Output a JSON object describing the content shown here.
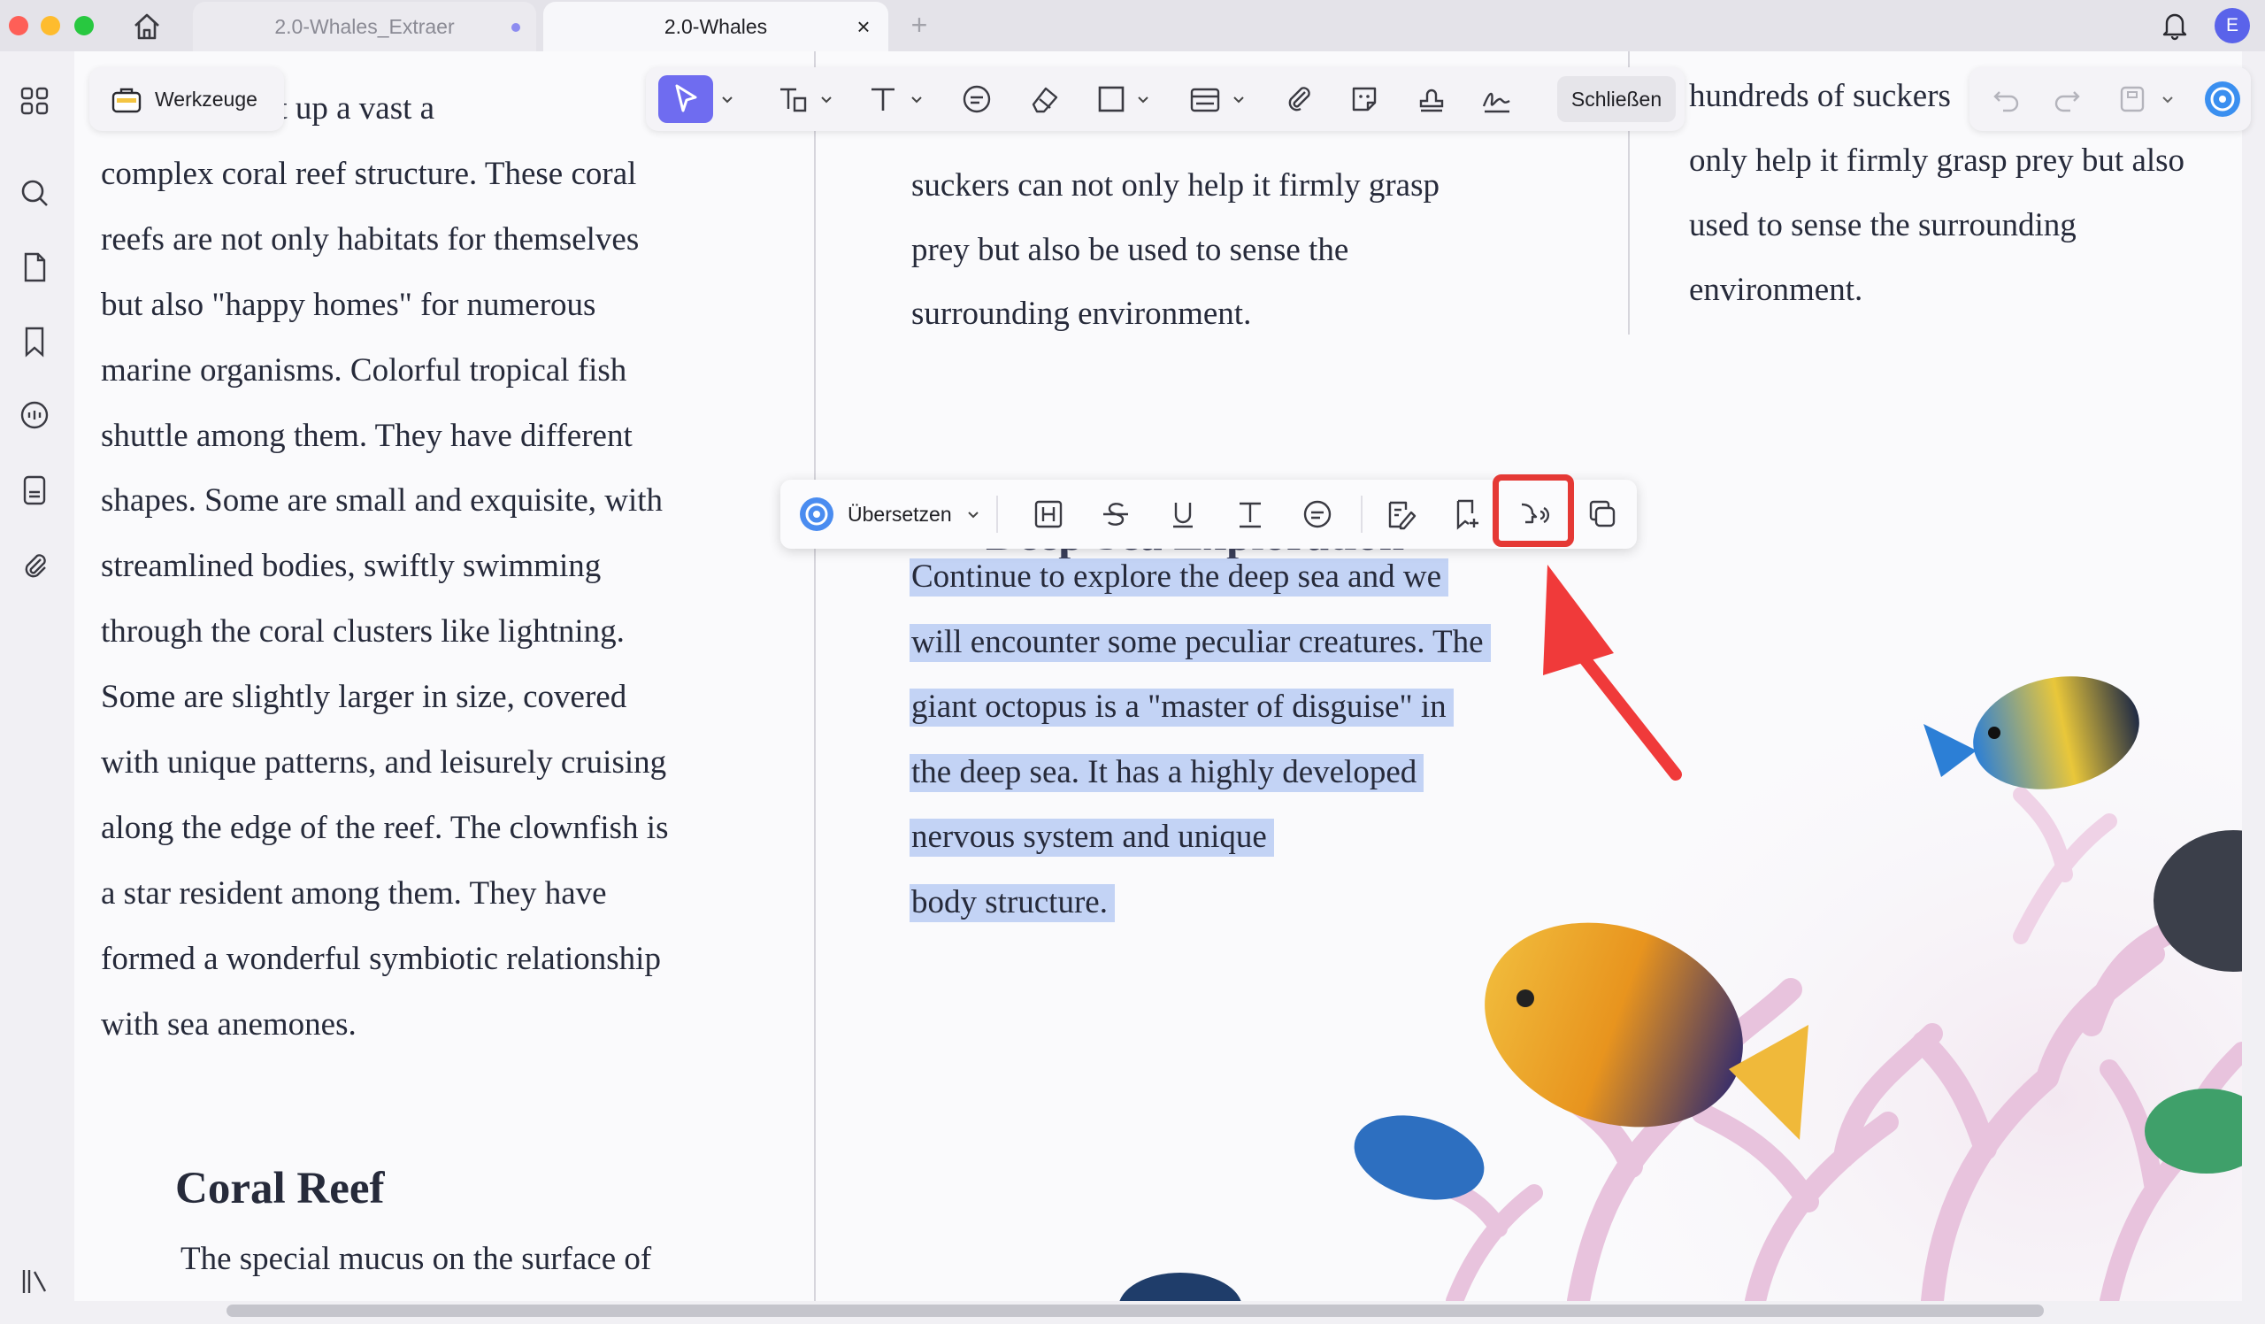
{
  "tabs": [
    {
      "label": "2.0-Whales_Extraer",
      "modified": true
    },
    {
      "label": "2.0-Whales",
      "active": true
    }
  ],
  "user": {
    "initial": "E"
  },
  "toolbar": {
    "tools_label": "Werkzeuge",
    "close_label": "Schließen"
  },
  "context_toolbar": {
    "translate_label": "Übersetzen"
  },
  "doc": {
    "col1_lines": [
      "me, have built up a vast a",
      "complex coral reef structure. These coral",
      "reefs are not only habitats for themselves",
      "but also \"happy homes\" for numerous",
      "marine organisms. Colorful tropical fish",
      "shuttle among them. They have different",
      "shapes. Some are small and exquisite, with",
      "streamlined bodies, swiftly swimming",
      "through the coral clusters like lightning.",
      "Some are slightly larger in size, covered",
      "with unique patterns, and leisurely cruising",
      "along the edge of the reef. The clownfish is",
      "a star resident among them. They have",
      "formed a wonderful symbiotic relationship",
      "with sea anemones."
    ],
    "coral_heading": "Coral Reef",
    "coral_para_start": "The special mucus on the surface of",
    "col2_top_lines": [
      "suckers can not only help it firmly grasp",
      "prey but also be used to sense the",
      "surrounding environment."
    ],
    "deep_heading": "Deep Sea Exploration",
    "selected_lines": [
      "Continue to explore the deep sea and we",
      "will encounter some peculiar creatures. The",
      "giant octopus is a \"master of disguise\" in",
      "the deep sea. It has a highly developed",
      "nervous system and unique",
      "body structure."
    ],
    "col3_lines": [
      "hundreds of suckers",
      "only help it firmly grasp prey but also",
      "used to sense the surrounding",
      "environment."
    ]
  },
  "colors": {
    "accent": "#6f6cf0",
    "selection": "#c3d3f5",
    "highlight_box": "#e53935",
    "arrow": "#f03a3a"
  }
}
